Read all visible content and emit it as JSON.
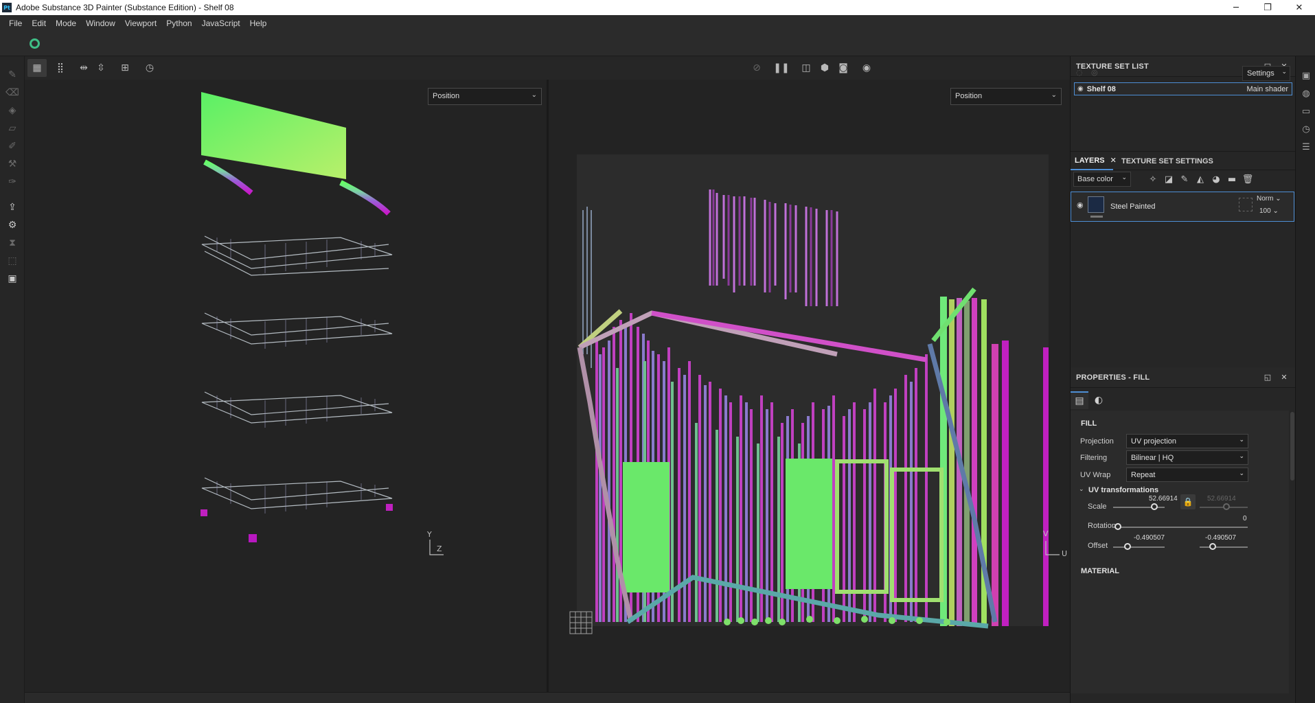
{
  "window": {
    "app_icon": "Pt",
    "title": "Adobe Substance 3D Painter (Substance Edition) - Shelf 08",
    "minimize": "─",
    "maximize": "❐",
    "close": "✕"
  },
  "menu": [
    "File",
    "Edit",
    "Mode",
    "Window",
    "Viewport",
    "Python",
    "JavaScript",
    "Help"
  ],
  "viewport_toolbar": {
    "left_icons": [
      "grid-single-icon",
      "grid-multi-icon",
      "mirror-x-icon",
      "mirror-y-icon",
      "frame-icon",
      "history-icon"
    ],
    "right_icons": [
      "hide-icon",
      "pause-icon",
      "split-view-icon",
      "cube-icon",
      "camera-icon",
      "screenshot-icon"
    ]
  },
  "viewport_3d": {
    "mode_select": "Position",
    "axis_y": "Y",
    "axis_z": "Z"
  },
  "viewport_2d": {
    "mode_select": "Position",
    "axis_v": "V",
    "axis_u": "U"
  },
  "texture_set_list": {
    "title": "TEXTURE SET LIST",
    "settings_label": "Settings",
    "items": [
      {
        "name": "Shelf 08",
        "shader": "Main shader"
      }
    ]
  },
  "layers": {
    "tabs": [
      {
        "label": "LAYERS",
        "active": true
      },
      {
        "label": "TEXTURE SET SETTINGS",
        "active": false
      }
    ],
    "channel": "Base color",
    "items": [
      {
        "name": "Steel Painted",
        "blend": "Norm",
        "opacity": "100"
      }
    ]
  },
  "properties": {
    "title": "PROPERTIES - FILL",
    "section": "FILL",
    "projection_label": "Projection",
    "projection_value": "UV projection",
    "filtering_label": "Filtering",
    "filtering_value": "Bilinear | HQ",
    "uvwrap_label": "UV Wrap",
    "uvwrap_value": "Repeat",
    "uv_transformations": "UV transformations",
    "scale_label": "Scale",
    "scale_u": "52.66914",
    "scale_v": "52.66914",
    "rotation_label": "Rotation",
    "rotation_value": "0",
    "offset_label": "Offset",
    "offset_u": "-0.490507",
    "offset_v": "-0.490507",
    "material_section": "MATERIAL"
  },
  "colors": {
    "accent": "#4e8fd6",
    "spinner": "#3fbd86",
    "panel_bg": "#262626",
    "viewport_bg": "#232323"
  }
}
